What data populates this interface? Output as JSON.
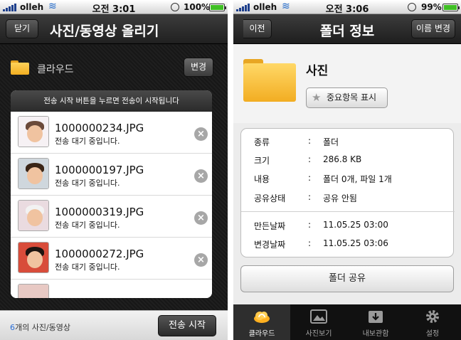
{
  "left": {
    "status": {
      "carrier": "olleh",
      "time": "오전 3:01",
      "battery": "100%",
      "battery_level": 1.0
    },
    "nav": {
      "close_label": "닫기",
      "title": "사진/동영상 올리기"
    },
    "destination": {
      "name": "클라우드",
      "change_label": "변경"
    },
    "panel": {
      "header": "전송 시작 버튼을 누르면 전송이 시작됩니다",
      "items": [
        {
          "filename": "1000000234.JPG",
          "status": "전송 대기 중입니다."
        },
        {
          "filename": "1000000197.JPG",
          "status": "전송 대기 중입니다."
        },
        {
          "filename": "1000000319.JPG",
          "status": "전송 대기 중입니다."
        },
        {
          "filename": "1000000272.JPG",
          "status": "전송 대기 중입니다."
        }
      ]
    },
    "footer": {
      "count": "6",
      "count_suffix": "개의 사진/동영상",
      "start_label": "전송 시작"
    }
  },
  "right": {
    "status": {
      "carrier": "olleh",
      "time": "오전 3:06",
      "battery": "99%",
      "battery_level": 0.99
    },
    "nav": {
      "back_label": "이전",
      "title": "폴더 정보",
      "rename_label": "이름 변경"
    },
    "folder": {
      "name": "사진",
      "favorite_label": "중요항목 표시"
    },
    "info": {
      "colon": ":",
      "rows": [
        {
          "key": "종류",
          "value": "폴더"
        },
        {
          "key": "크기",
          "value": "286.8 KB"
        },
        {
          "key": "내용",
          "value": "폴더 0개, 파일 1개"
        },
        {
          "key": "공유상태",
          "value": "공유 안됨"
        },
        {
          "key": "만든날짜",
          "value": "11.05.25 03:00"
        },
        {
          "key": "변경날짜",
          "value": "11.05.25 03:06"
        }
      ]
    },
    "share_label": "폴더 공유",
    "tabs": [
      {
        "label": "클라우드",
        "icon": "cloud-icon",
        "selected": true
      },
      {
        "label": "사진보기",
        "icon": "photo-icon",
        "selected": false
      },
      {
        "label": "내보관함",
        "icon": "download-box-icon",
        "selected": false
      },
      {
        "label": "설정",
        "icon": "gear-icon",
        "selected": false
      }
    ]
  },
  "colors": {
    "accent_blue": "#2a6ed6",
    "folder_yellow": "#f2ae21",
    "battery_green": "#3fbf24"
  }
}
